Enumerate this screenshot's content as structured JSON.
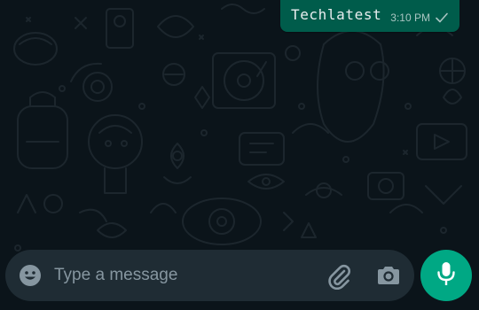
{
  "chat": {
    "messages": [
      {
        "text": "Techlatest",
        "time": "3:10 PM",
        "status_icon": "single-check-icon"
      }
    ]
  },
  "composer": {
    "placeholder": "Type a message",
    "value": "",
    "icons": [
      "emoji-icon",
      "paperclip-icon",
      "camera-icon"
    ]
  },
  "mic_button": {
    "icon": "microphone-icon"
  },
  "colors": {
    "background": "#0b141a",
    "doodle": "#1c262d",
    "bubble_outgoing": "#005c4b",
    "composer_bg": "#1f2c34",
    "accent": "#00a884",
    "placeholder": "#8696a0",
    "icon": "#8696a0"
  }
}
